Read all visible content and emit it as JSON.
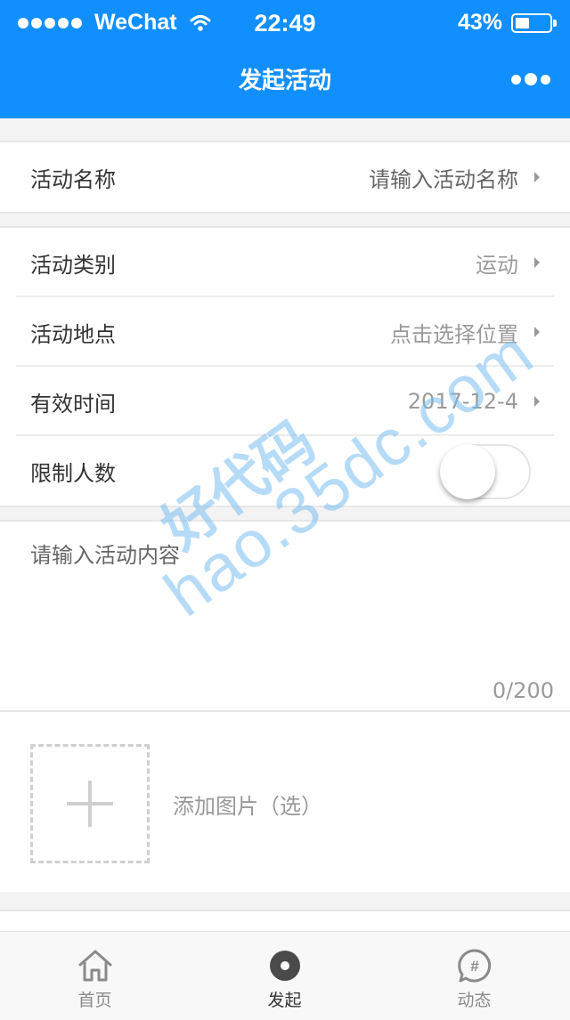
{
  "status_bar": {
    "carrier": "WeChat",
    "time": "22:49",
    "battery": "43%",
    "battery_level": 0.43
  },
  "nav": {
    "title": "发起活动"
  },
  "form": {
    "name": {
      "label": "活动名称",
      "placeholder": "请输入活动名称"
    },
    "category": {
      "label": "活动类别",
      "value": "运动"
    },
    "location": {
      "label": "活动地点",
      "value": "点击选择位置"
    },
    "valid_time": {
      "label": "有效时间",
      "value": "2017-12-4"
    },
    "limit": {
      "label": "限制人数",
      "enabled": false
    },
    "content": {
      "placeholder": "请输入活动内容",
      "counter": "0/200"
    },
    "photo": {
      "label": "添加图片（选）"
    }
  },
  "tabbar": {
    "items": [
      {
        "label": "首页",
        "icon": "home-icon",
        "active": false
      },
      {
        "label": "发起",
        "icon": "publish-icon",
        "active": true
      },
      {
        "label": "动态",
        "icon": "topic-icon",
        "active": false
      }
    ]
  },
  "watermark": {
    "line1": "好代码",
    "line2": "hao.35dc.com"
  },
  "colors": {
    "primary": "#118fff",
    "text": "#333333",
    "muted": "#9a9a9a"
  }
}
